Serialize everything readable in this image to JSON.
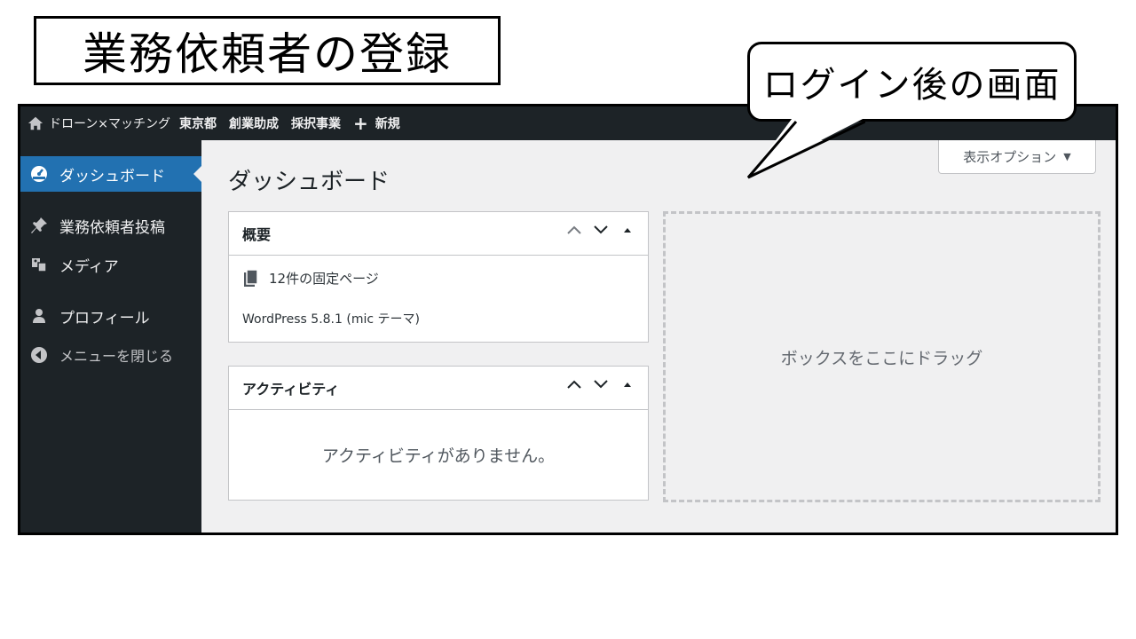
{
  "slide": {
    "title": "業務依頼者の登録",
    "callout": "ログイン後の画面"
  },
  "adminbar": {
    "site_name": "ドローン×マッチング",
    "links": [
      "東京都",
      "創業助成",
      "採択事業"
    ],
    "new_label": "新規"
  },
  "sidebar": {
    "items": [
      {
        "label": "ダッシュボード",
        "icon": "dashboard-icon",
        "active": true
      },
      {
        "label": "業務依頼者投稿",
        "icon": "pin-icon"
      },
      {
        "label": "メディア",
        "icon": "media-icon"
      },
      {
        "label": "プロフィール",
        "icon": "user-icon"
      },
      {
        "label": "メニューを閉じる",
        "icon": "collapse-icon"
      }
    ]
  },
  "main": {
    "page_title": "ダッシュボード",
    "screen_options": "表示オプション",
    "glance": {
      "title": "概要",
      "pages_count": "12件の固定ページ",
      "version_text": "WordPress 5.8.1 (mic テーマ)"
    },
    "activity": {
      "title": "アクティビティ",
      "empty_message": "アクティビティがありません。"
    },
    "drop_zone": "ボックスをここにドラッグ"
  },
  "colors": {
    "admin_bg": "#1d2327",
    "active_bg": "#2271b1",
    "content_bg": "#f0f0f1"
  }
}
